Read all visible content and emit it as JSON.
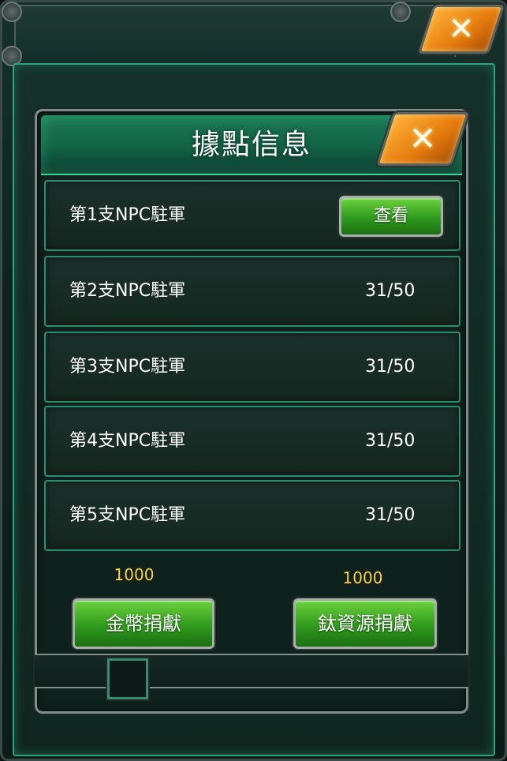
{
  "outer_window": {
    "close_icon": "close-x-icon"
  },
  "dialog": {
    "title": "據點信息",
    "close_icon": "close-x-icon",
    "rows": [
      {
        "label": "第1支NPC駐軍",
        "button_label": "查看"
      },
      {
        "label": "第2支NPC駐軍",
        "value": "31/50"
      },
      {
        "label": "第3支NPC駐軍",
        "value": "31/50"
      },
      {
        "label": "第4支NPC駐軍",
        "value": "31/50"
      },
      {
        "label": "第5支NPC駐軍",
        "value": "31/50"
      }
    ],
    "gold_donate": {
      "cost": "1000",
      "label": "金幣捐獻"
    },
    "titanium_donate": {
      "cost": "1000",
      "label": "鈦資源捐獻"
    }
  },
  "colors": {
    "accent_green": "#2ea27a",
    "button_green": "#2f9a1d",
    "cost_yellow": "#ffd23a",
    "close_orange": "#e47b0c"
  }
}
